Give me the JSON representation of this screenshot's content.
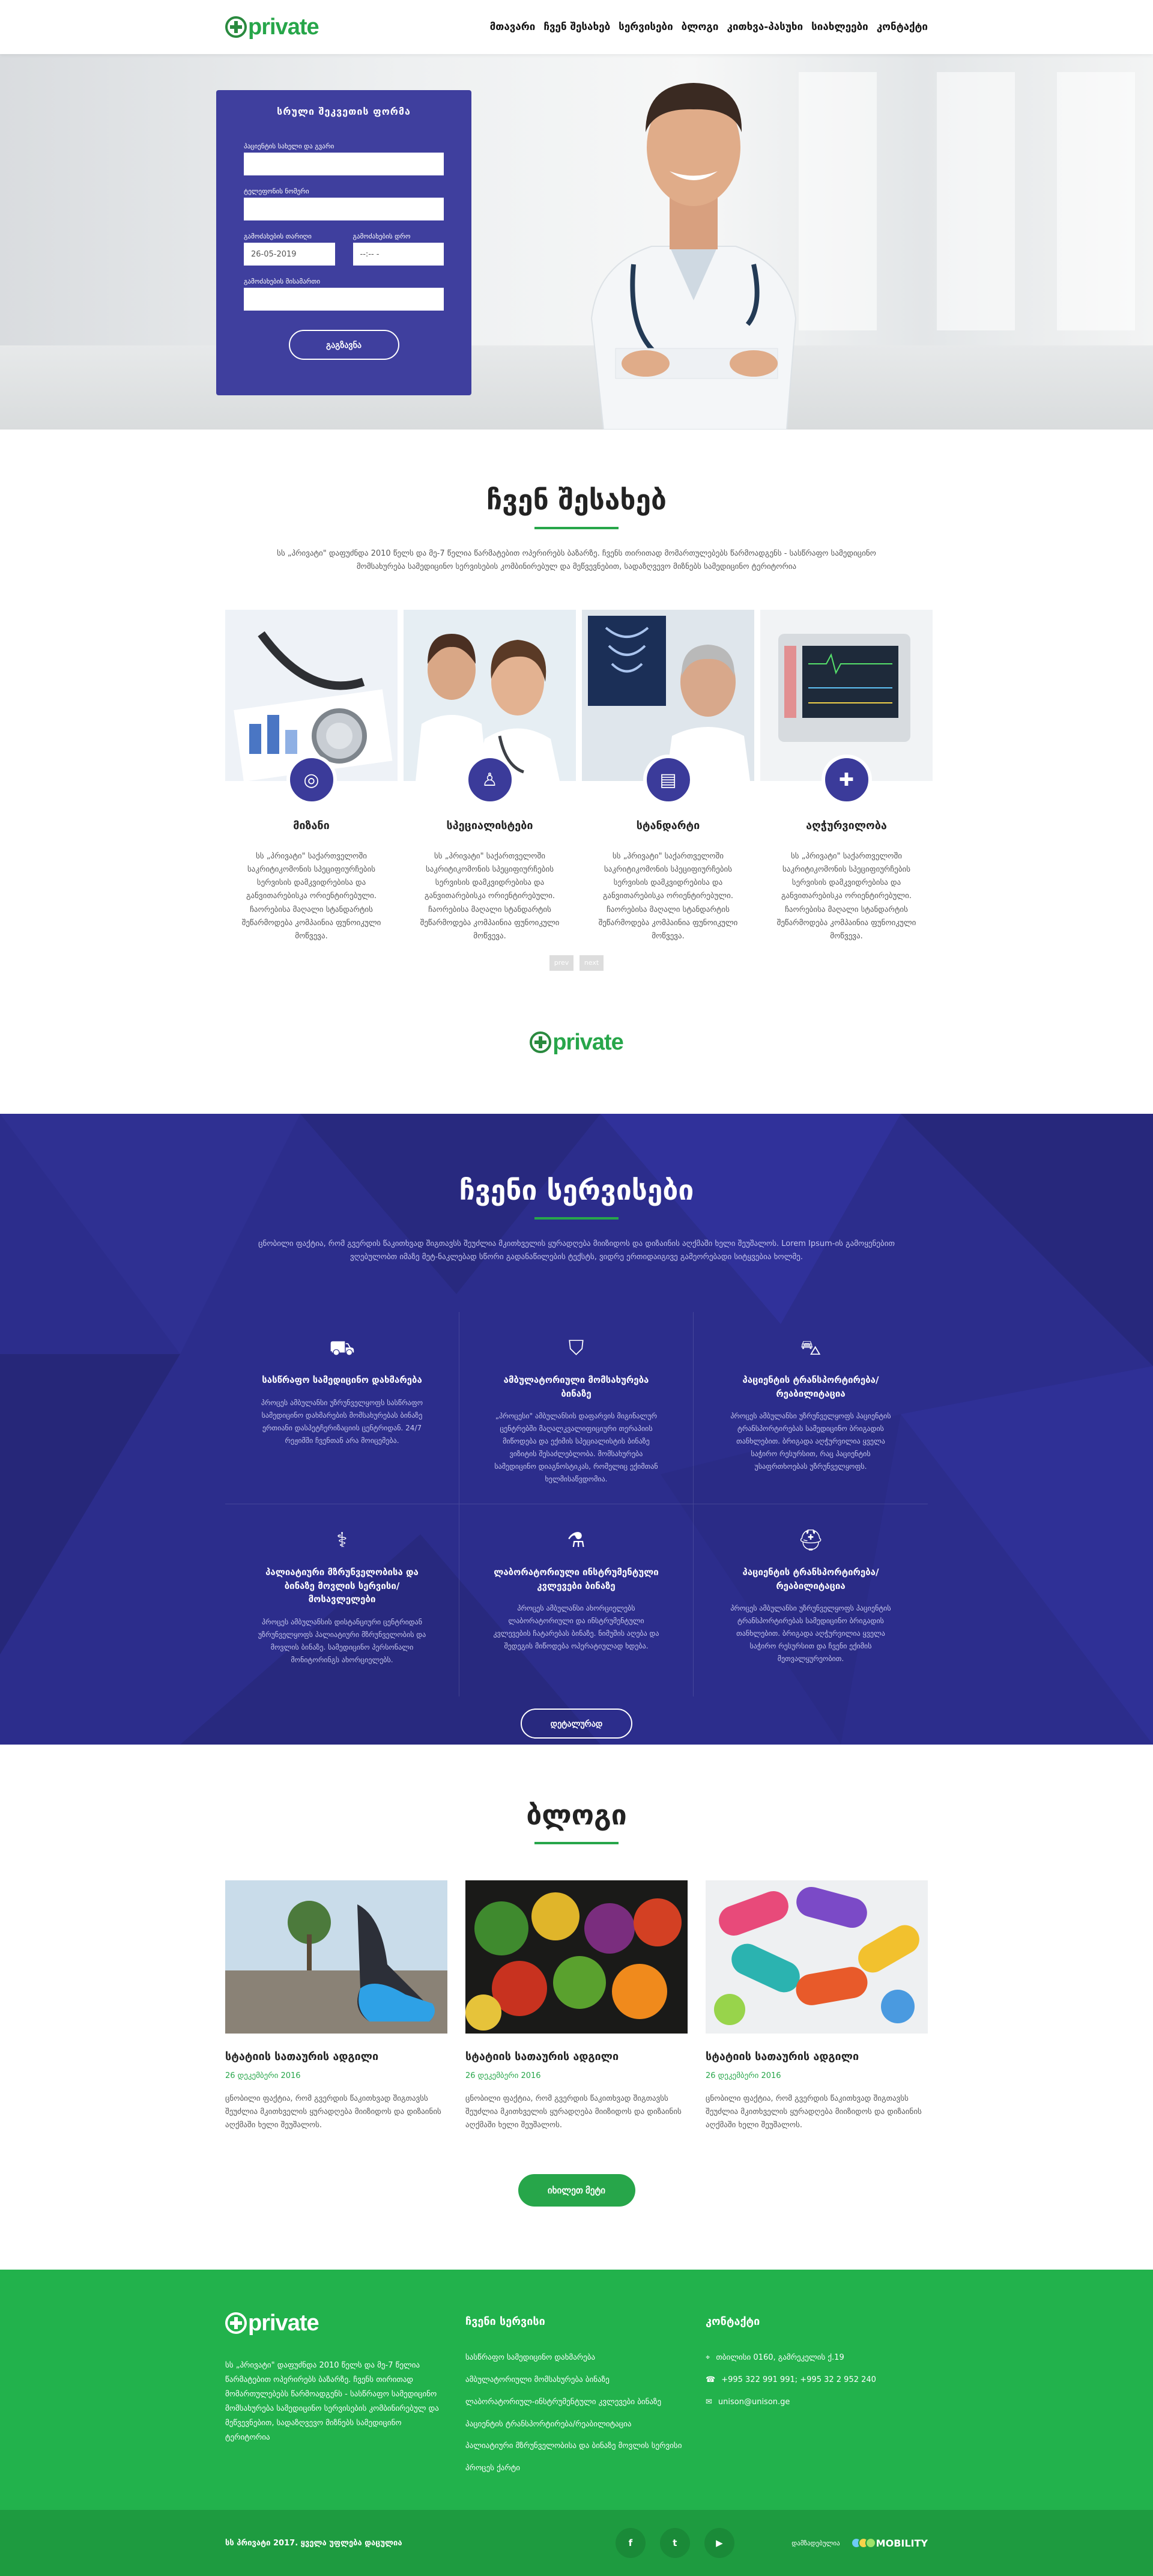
{
  "header": {
    "logo_text": "private",
    "nav": [
      "მთავარი",
      "ჩვენ შესახებ",
      "სერვისები",
      "ბლოგი",
      "კითხვა-პასუხი",
      "სიახლეები",
      "კონტაქტი"
    ]
  },
  "hero": {
    "form_title": "სრული შეკვეთის ფორმა",
    "name_label": "პაციენტის სახელი და გვარი",
    "phone_label": "ტელეფონის ნომერი",
    "date_label": "გამოძახების თარიღი",
    "time_label": "გამოძახების დრო",
    "date_value": "26-05-2019",
    "time_value": "--:-- -",
    "address_label": "გამოძახების მისამართი",
    "submit": "გაგზავნა"
  },
  "about": {
    "title": "ჩვენ შესახებ",
    "lead": "სს „პრივატი\" დაფუძნდა 2010 წელს და მე-7 წელია წარმატებით ოპერირებს ბაზარზე. ჩვენს თირითად მომართულებებს წარმოადგენს - სასწრაფო სამედიცინო მომსახურება სამედიცინო სერვისების კომბინირებულ და მეწვევნებით, სადაზღვევო მიზნებს სამედიცინო ტერიტორია",
    "cards": [
      {
        "icon": "target-icon",
        "title": "მიზანი",
        "text": "სს „პრივატი\" საქართველოში საკრიტიკომონის სპეციფიურჩების სერვისის დამკვიდრებისა და განვითარებისკა ორიენტირებული. ჩაორებისა მაღალი სტანდარტის შეწარმოდება კომპაინია ფუნოიკული მოწვევა."
      },
      {
        "icon": "specialist-icon",
        "title": "სპეციალისტები",
        "text": "სს „პრივატი\" საქართველოში საკრიტიკომონის სპეციფიურჩების სერვისის დამკვიდრებისა და განვითარებისკა ორიენტირებული. ჩაორებისა მაღალი სტანდარტის შეწარმოდება კომპაინია ფუნოიკული მოწვევა."
      },
      {
        "icon": "document-icon",
        "title": "სტანდარტი",
        "text": "სს „პრივატი\" საქართველოში საკრიტიკომონის სპეციფიურჩების სერვისის დამკვიდრებისა და განვითარებისკა ორიენტირებული. ჩაორებისა მაღალი სტანდარტის შეწარმოდება კომპაინია ფუნოიკული მოწვევა."
      },
      {
        "icon": "medical-kit-icon",
        "title": "აღჭურვილობა",
        "text": "სს „პრივატი\" საქართველოში საკრიტიკომონის სპეციფიურჩების სერვისის დამკვიდრებისა და განვითარებისკა ორიენტირებული. ჩაორებისა მაღალი სტანდარტის შეწარმოდება კომპაინია ფუნოიკული მოწვევა."
      }
    ],
    "prev": "prev",
    "next": "next"
  },
  "services": {
    "title": "ჩვენი სერვისები",
    "lead": "ცნობილი ფაქტია, რომ გვერდის წაკითხვად შიგთავსს შეუძლია მკითხველის ყურადღება მიიზიდოს და დიზაინის აღქმაში ხელი შეუშალოს. Lorem Ipsum-ის გამოყენებით ვღებულობთ იმაზე მეტ-ნაკლებად სწორი გადანაწილების ტექსტს, ვიდრე ერთიდაიგივე გამეორებადი სიტყვებია ხოლმე.",
    "items": [
      {
        "icon": "ambulance-icon",
        "title": "სასწრაფო სამედიცინო დახმარება",
        "text": "პროცეს ამბულანსი უზრუნველყოფს სასწრაფო სამედიცინო დახმარების მომსახურებას ბინაზე ერთიანი დასპეტჩერიზაციის ცენტრიდან. 24/7 რეჟიმში ჩვენთან არა მოიცემება."
      },
      {
        "icon": "hospital-bed-icon",
        "title": "ამბულატორიული მომსახურება ბინაზე",
        "text": "„პროცესი\" ამბულანსის დაფარვის მიგინალურ ცენტრებში მაღალკვალიფიციური თერაპიის მიწოდება და ექიმის სპეციალისტის ბინაზე ვიზიტის შესაძლებლობა. მომსახურება სამედიცინო დიაგნოსტიკას, რომელიც ექიმთან ხელმისაწვდომია."
      },
      {
        "icon": "transport-icon",
        "title": "პაციენტის ტრანსპორტირება/რეაბილიტაცია",
        "text": "პროცეს ამბულანსი უზრუნველყოფს პაციენტის ტრანსპორტირებას სამედიცინო ბრიგადის თანხლებით. ბრიგადა აღჭურვილია ყველა საჭირო რესურსით, რაც პაციენტის უსაფრთხოებას უზრუნველყოფს."
      },
      {
        "icon": "stethoscope-icon",
        "title": "პალიატიური მზრუნველობისა და ბინაზე მოვლის სერვისი/მოსავლელები",
        "text": "პროცეს ამბულანსის დისტანციური ცენტრიდან უზრუნველყოფს პალიატიური მზრუნველობის და მოვლის ბინაზე. სამედიცინო პერსონალი მონიტორინგს ახორციელებს."
      },
      {
        "icon": "microscope-icon",
        "title": "ლაბორატორიული ინსტრუმენტული კვლევები ბინაზე",
        "text": "პროცეს ამბულანსი ახორციელებს ლაბორატორიული და ინსტრუმენტული კვლევების ჩატარებას ბინაზე. ნიმუშის აღება და შედეგის მიწოდება ოპერატიულად ხდება."
      },
      {
        "icon": "nurse-icon",
        "title": "პაციენტის ტრანსპორტირება/რეაბილიტაცია",
        "text": "პროცეს ამბულანსი უზრუნველყოფს პაციენტის ტრანსპორტირებას სამედიცინო ბრიგადის თანხლებით. ბრიგადა აღჭურვილია ყველა საჭირო რესურსით და ჩვენი ექიმის მეთვალყურეობით."
      }
    ],
    "button": "დეტალურად"
  },
  "blog": {
    "title": "ბლოგი",
    "posts": [
      {
        "title": "სტატიის სათაურის ადგილი",
        "date": "26 დეკემბერი 2016",
        "text": "ცნობილი ფაქტია, რომ გვერდის წაკითხვად შიგთავსს შეუძლია მკითხველის ყურადღება მიიზიდოს და დიზაინის აღქმაში ხელი შეუშალოს."
      },
      {
        "title": "სტატიის სათაურის ადგილი",
        "date": "26 დეკემბერი 2016",
        "text": "ცნობილი ფაქტია, რომ გვერდის წაკითხვად შიგთავსს შეუძლია მკითხველის ყურადღება მიიზიდოს და დიზაინის აღქმაში ხელი შეუშალოს."
      },
      {
        "title": "სტატიის სათაურის ადგილი",
        "date": "26 დეკემბერი 2016",
        "text": "ცნობილი ფაქტია, რომ გვერდის წაკითხვად შიგთავსს შეუძლია მკითხველის ყურადღება მიიზიდოს და დიზაინის აღქმაში ხელი შეუშალოს."
      }
    ],
    "more": "იხილეთ მეტი"
  },
  "footer": {
    "about_text": "სს „პრივატი\" დაფუძნდა 2010 წელს და მე-7 წელია წარმატებით ოპერირებს ბაზარზე. ჩვენს თირითად მომართულებებს წარმოადგენს - სასწრაფო სამედიცინო მომსახურება სამედიცინო სერვისების კომბინირებულ და მეწვევნებით, სადაზღვევო მიზნებს სამედიცინო ტერიტორია",
    "services_title": "ჩვენი სერვისი",
    "services": [
      "სასწრაფო სამედიცინო დახმარება",
      "ამბულატორიული მომსახურება ბინაზე",
      "ლაბორატორიულ-ინსტრუმენტული კვლევები ბინაზე",
      "პაციენტის ტრანსპორტირება/რეაბილიტაცია",
      "პალიატიური მზრუნველობისა და ბინაზე მოვლის სერვისი",
      "პროცეს ქარტი"
    ],
    "contact_title": "კონტაქტი",
    "address": "თბილისი 0160, გამრეკელის ქ.19",
    "phone": "+995 322 991 991; +995 32 2 952 240",
    "email": "unison@unison.ge",
    "copyright": "სს პრივატი 2017. ყველა უფლება დაცულია",
    "socials": [
      "f",
      "t",
      "▶"
    ],
    "made_by": "დამზადებულია",
    "developer": "MOBILITY"
  },
  "colors": {
    "green": "#27a64a",
    "navy": "#2c2d8c",
    "card_blue": "#3f3f9e"
  }
}
